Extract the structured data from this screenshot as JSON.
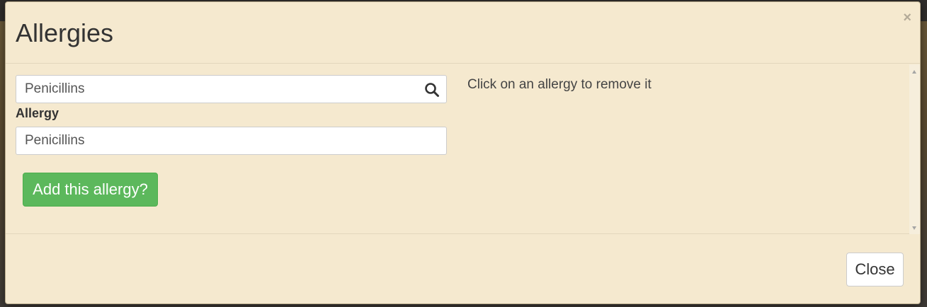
{
  "modal": {
    "title": "Allergies",
    "close_symbol": "×"
  },
  "search": {
    "value": "Penicillins",
    "icon": "search-icon"
  },
  "allergy": {
    "label": "Allergy",
    "value": "Penicillins"
  },
  "actions": {
    "add_label": "Add this allergy?",
    "close_label": "Close"
  },
  "instruction": "Click on an allergy to remove it",
  "colors": {
    "modal_background": "#f5e9cf",
    "success_button": "#5cb85c"
  }
}
